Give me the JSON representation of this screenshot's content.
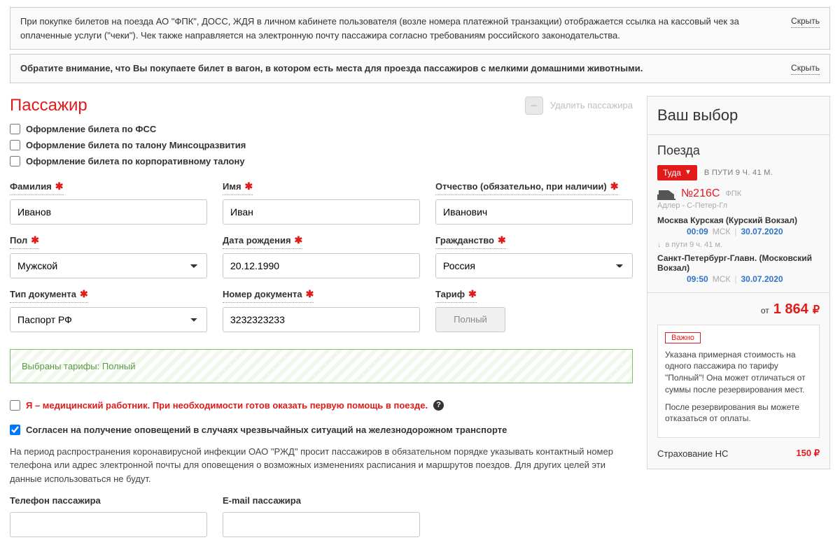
{
  "notices": {
    "n1": "При покупке билетов на поезда АО \"ФПК\", ДОСС, ЖДЯ в личном кабинете пользователя (возле номера платежной транзакции) отображается ссылка на кассовый чек за оплаченные услуги (\"чеки\"). Чек также направляется на электронную почту пассажира согласно требованиям российского законодательства.",
    "n2": "Обратите внимание, что Вы покупаете билет в вагон, в котором есть места для проезда пассажиров с мелкими домашними животными.",
    "hide": "Скрыть"
  },
  "passenger": {
    "title": "Пассажир",
    "deleteLabel": "Удалить пассажира",
    "opt_fss": "Оформление билета по ФСС",
    "opt_minsoc": "Оформление билета по талону Минсоцразвития",
    "opt_corp": "Оформление билета по корпоративному талону",
    "labels": {
      "lastname": "Фамилия",
      "firstname": "Имя",
      "middlename": "Отчество (обязательно, при наличии)",
      "gender": "Пол",
      "dob": "Дата рождения",
      "citizenship": "Гражданство",
      "doctype": "Тип документа",
      "docnum": "Номер документа",
      "tariff": "Тариф",
      "phone": "Телефон пассажира",
      "email": "E-mail пассажира"
    },
    "values": {
      "lastname": "Иванов",
      "firstname": "Иван",
      "middlename": "Иванович",
      "gender": "Мужской",
      "dob": "20.12.1990",
      "citizenship": "Россия",
      "doctype": "Паспорт РФ",
      "docnum": "3232323233",
      "tariff_btn": "Полный"
    },
    "tariff_selected": "Выбраны тарифы: Полный",
    "medical": "Я – медицинский работник. При необходимости готов оказать первую помощь в поезде.",
    "agree": "Согласен на получение оповещений в случаях чрезвычайных ситуаций на железнодорожном транспорте",
    "covid_info": "На период распространения коронавирусной инфекции ОАО \"РЖД\" просит пассажиров в обязательном порядке указывать контактный номер телефона или адрес электронной почты для оповещения о возможных изменениях расписания и маршрутов поездов. Для других целей эти данные использоваться не будут."
  },
  "sidebar": {
    "title": "Ваш выбор",
    "section": "Поезда",
    "direction": "Туда",
    "duration_label": "В ПУТИ 9 Ч. 41 М.",
    "train_number": "№216С",
    "carrier": "ФПК",
    "route": "Адлер - С-Петер-Гл",
    "from_station": "Москва Курская (Курский Вокзал)",
    "from_time": "00:09",
    "from_tz": "МСК",
    "from_date": "30.07.2020",
    "transit": "в пути  9 ч. 41 м.",
    "to_station": "Санкт-Петербург-Главн. (Московский Вокзал)",
    "to_time": "09:50",
    "to_tz": "МСК",
    "to_date": "30.07.2020",
    "price_from": "от",
    "price": "1 864",
    "currency": "₽",
    "important_label": "Важно",
    "important_p1": "Указана примерная стоимость на одного пассажира по тарифу \"Полный\"! Она может отличаться от суммы после резервирования мест.",
    "important_p2": "После резервирования вы можете отказаться от оплаты.",
    "insurance_label": "Страхование НС",
    "insurance_price": "150 ₽"
  }
}
